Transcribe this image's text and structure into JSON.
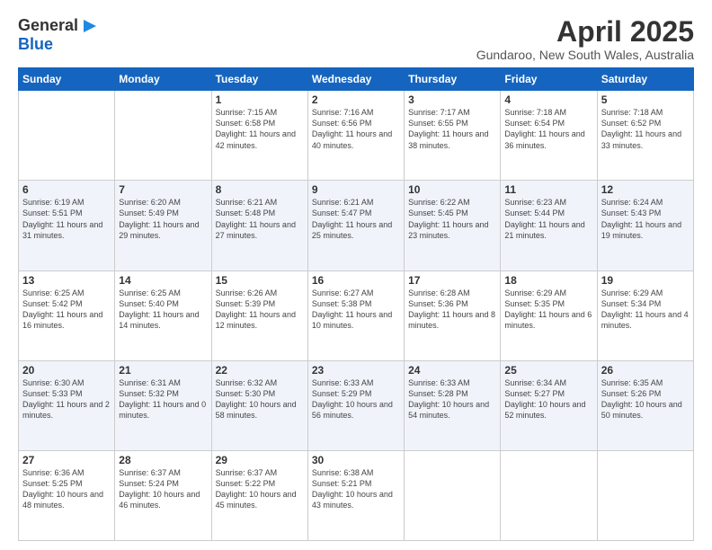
{
  "header": {
    "logo_line1": "General",
    "logo_line2": "Blue",
    "title": "April 2025",
    "subtitle": "Gundaroo, New South Wales, Australia"
  },
  "days_of_week": [
    "Sunday",
    "Monday",
    "Tuesday",
    "Wednesday",
    "Thursday",
    "Friday",
    "Saturday"
  ],
  "weeks": [
    [
      {
        "day": "",
        "info": ""
      },
      {
        "day": "",
        "info": ""
      },
      {
        "day": "1",
        "info": "Sunrise: 7:15 AM\nSunset: 6:58 PM\nDaylight: 11 hours and 42 minutes."
      },
      {
        "day": "2",
        "info": "Sunrise: 7:16 AM\nSunset: 6:56 PM\nDaylight: 11 hours and 40 minutes."
      },
      {
        "day": "3",
        "info": "Sunrise: 7:17 AM\nSunset: 6:55 PM\nDaylight: 11 hours and 38 minutes."
      },
      {
        "day": "4",
        "info": "Sunrise: 7:18 AM\nSunset: 6:54 PM\nDaylight: 11 hours and 36 minutes."
      },
      {
        "day": "5",
        "info": "Sunrise: 7:18 AM\nSunset: 6:52 PM\nDaylight: 11 hours and 33 minutes."
      }
    ],
    [
      {
        "day": "6",
        "info": "Sunrise: 6:19 AM\nSunset: 5:51 PM\nDaylight: 11 hours and 31 minutes."
      },
      {
        "day": "7",
        "info": "Sunrise: 6:20 AM\nSunset: 5:49 PM\nDaylight: 11 hours and 29 minutes."
      },
      {
        "day": "8",
        "info": "Sunrise: 6:21 AM\nSunset: 5:48 PM\nDaylight: 11 hours and 27 minutes."
      },
      {
        "day": "9",
        "info": "Sunrise: 6:21 AM\nSunset: 5:47 PM\nDaylight: 11 hours and 25 minutes."
      },
      {
        "day": "10",
        "info": "Sunrise: 6:22 AM\nSunset: 5:45 PM\nDaylight: 11 hours and 23 minutes."
      },
      {
        "day": "11",
        "info": "Sunrise: 6:23 AM\nSunset: 5:44 PM\nDaylight: 11 hours and 21 minutes."
      },
      {
        "day": "12",
        "info": "Sunrise: 6:24 AM\nSunset: 5:43 PM\nDaylight: 11 hours and 19 minutes."
      }
    ],
    [
      {
        "day": "13",
        "info": "Sunrise: 6:25 AM\nSunset: 5:42 PM\nDaylight: 11 hours and 16 minutes."
      },
      {
        "day": "14",
        "info": "Sunrise: 6:25 AM\nSunset: 5:40 PM\nDaylight: 11 hours and 14 minutes."
      },
      {
        "day": "15",
        "info": "Sunrise: 6:26 AM\nSunset: 5:39 PM\nDaylight: 11 hours and 12 minutes."
      },
      {
        "day": "16",
        "info": "Sunrise: 6:27 AM\nSunset: 5:38 PM\nDaylight: 11 hours and 10 minutes."
      },
      {
        "day": "17",
        "info": "Sunrise: 6:28 AM\nSunset: 5:36 PM\nDaylight: 11 hours and 8 minutes."
      },
      {
        "day": "18",
        "info": "Sunrise: 6:29 AM\nSunset: 5:35 PM\nDaylight: 11 hours and 6 minutes."
      },
      {
        "day": "19",
        "info": "Sunrise: 6:29 AM\nSunset: 5:34 PM\nDaylight: 11 hours and 4 minutes."
      }
    ],
    [
      {
        "day": "20",
        "info": "Sunrise: 6:30 AM\nSunset: 5:33 PM\nDaylight: 11 hours and 2 minutes."
      },
      {
        "day": "21",
        "info": "Sunrise: 6:31 AM\nSunset: 5:32 PM\nDaylight: 11 hours and 0 minutes."
      },
      {
        "day": "22",
        "info": "Sunrise: 6:32 AM\nSunset: 5:30 PM\nDaylight: 10 hours and 58 minutes."
      },
      {
        "day": "23",
        "info": "Sunrise: 6:33 AM\nSunset: 5:29 PM\nDaylight: 10 hours and 56 minutes."
      },
      {
        "day": "24",
        "info": "Sunrise: 6:33 AM\nSunset: 5:28 PM\nDaylight: 10 hours and 54 minutes."
      },
      {
        "day": "25",
        "info": "Sunrise: 6:34 AM\nSunset: 5:27 PM\nDaylight: 10 hours and 52 minutes."
      },
      {
        "day": "26",
        "info": "Sunrise: 6:35 AM\nSunset: 5:26 PM\nDaylight: 10 hours and 50 minutes."
      }
    ],
    [
      {
        "day": "27",
        "info": "Sunrise: 6:36 AM\nSunset: 5:25 PM\nDaylight: 10 hours and 48 minutes."
      },
      {
        "day": "28",
        "info": "Sunrise: 6:37 AM\nSunset: 5:24 PM\nDaylight: 10 hours and 46 minutes."
      },
      {
        "day": "29",
        "info": "Sunrise: 6:37 AM\nSunset: 5:22 PM\nDaylight: 10 hours and 45 minutes."
      },
      {
        "day": "30",
        "info": "Sunrise: 6:38 AM\nSunset: 5:21 PM\nDaylight: 10 hours and 43 minutes."
      },
      {
        "day": "",
        "info": ""
      },
      {
        "day": "",
        "info": ""
      },
      {
        "day": "",
        "info": ""
      }
    ]
  ]
}
